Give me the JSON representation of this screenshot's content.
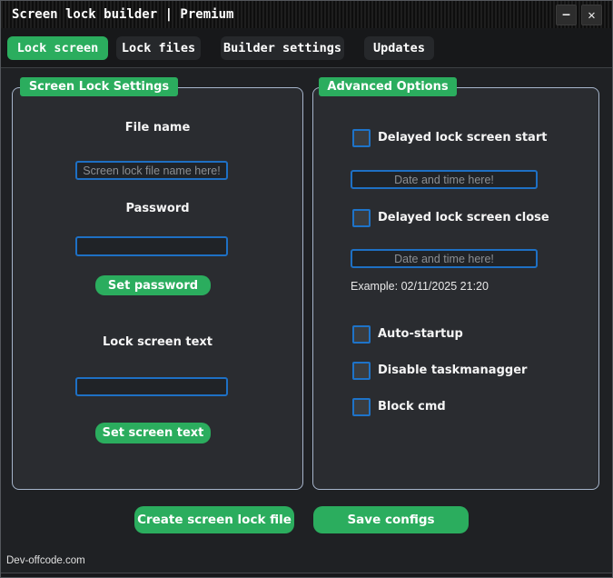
{
  "window": {
    "title": "Screen lock builder | Premium",
    "minimize_glyph": "–",
    "close_glyph": "✕",
    "footer_text": "Dev-offcode.com"
  },
  "tabs": [
    {
      "label": "Lock screen",
      "active": true
    },
    {
      "label": "Lock files",
      "active": false
    },
    {
      "label": "Builder settings",
      "active": false
    },
    {
      "label": "Updates",
      "active": false
    }
  ],
  "screen_lock_settings": {
    "title": "Screen Lock Settings",
    "file_name_label": "File name",
    "file_name_placeholder": "Screen lock file name here!",
    "file_name_value": "",
    "password_label": "Password",
    "password_value": "",
    "set_password_button": "Set password",
    "lock_screen_text_label": "Lock screen text",
    "lock_screen_text_value": "",
    "set_screen_text_button": "Set screen text"
  },
  "advanced_options": {
    "title": "Advanced Options",
    "delayed_start": {
      "label": "Delayed lock screen start",
      "checked": false,
      "placeholder": "Date and time here!",
      "value": ""
    },
    "delayed_close": {
      "label": "Delayed lock screen close",
      "checked": false,
      "placeholder": "Date and time here!",
      "value": ""
    },
    "example_text": "Example: 02/11/2025 21:20",
    "auto_startup": {
      "label": "Auto-startup",
      "checked": false
    },
    "disable_taskmanager": {
      "label": "Disable taskmanagger",
      "checked": false
    },
    "block_cmd": {
      "label": "Block cmd",
      "checked": false
    }
  },
  "actions": {
    "create_button": "Create screen lock file",
    "save_button": "Save configs"
  },
  "colors": {
    "accent_green": "#2bad5e",
    "accent_blue": "#1e73c8",
    "groupbox_border": "#a6b5cb",
    "window_background": "#1f2124",
    "groupbox_background": "#2a2c30"
  }
}
